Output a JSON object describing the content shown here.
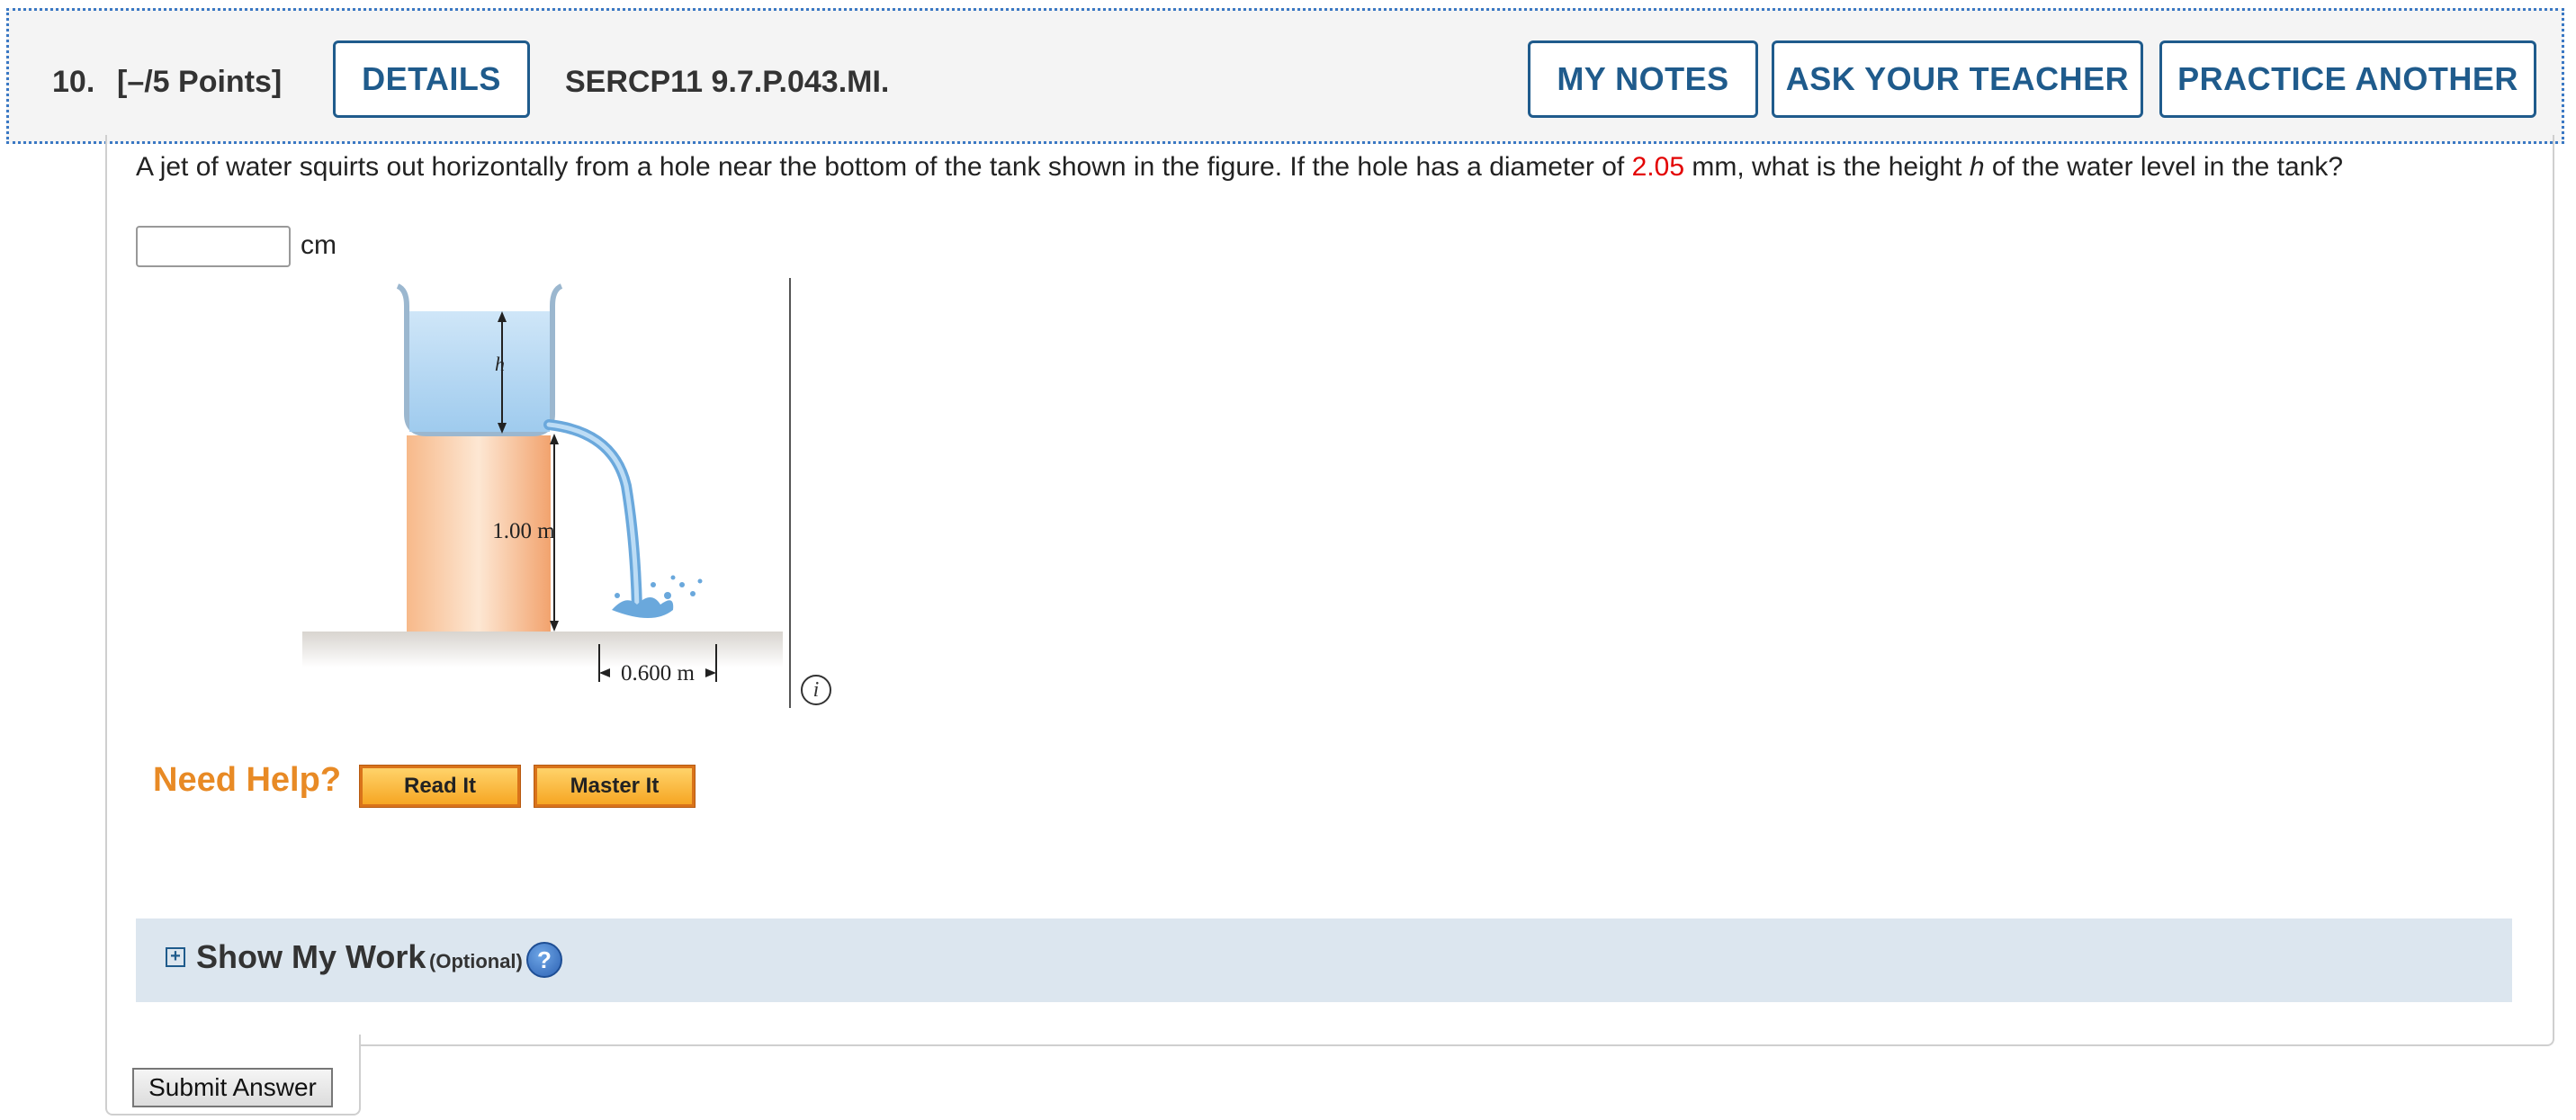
{
  "header": {
    "number": "10.",
    "points": "[–/5 Points]",
    "details_label": "DETAILS",
    "code": "SERCP11 9.7.P.043.MI.",
    "my_notes_label": "MY NOTES",
    "ask_teacher_label": "ASK YOUR TEACHER",
    "practice_label": "PRACTICE ANOTHER"
  },
  "question": {
    "text_before": "A jet of water squirts out horizontally from a hole near the bottom of the tank shown in the figure. If the hole has a diameter of ",
    "diameter_value": "2.05",
    "text_middle": " mm, what is the height ",
    "var_h": "h",
    "text_after": " of the water level in the tank?",
    "answer_value": "",
    "unit": "cm"
  },
  "figure": {
    "label_h": "h",
    "label_height": "1.00 m",
    "label_distance": "0.600 m",
    "info_icon": "i"
  },
  "help": {
    "need_help": "Need Help?",
    "read_it": "Read It",
    "master_it": "Master It"
  },
  "work": {
    "expand_symbol": "+",
    "title": "Show My Work",
    "optional": "(Optional)",
    "help_icon": "?"
  },
  "submit_label": "Submit Answer",
  "colors": {
    "accent": "#1f5b8c",
    "highlight": "#e30000",
    "help_orange": "#e88a25",
    "work_bg": "#dce6ef"
  }
}
